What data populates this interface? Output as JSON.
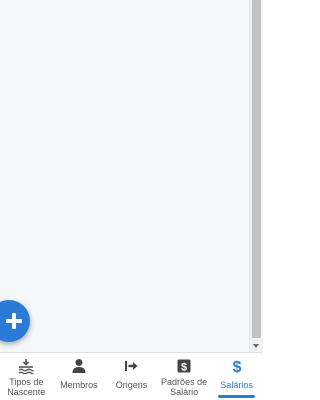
{
  "fab": {
    "icon": "plus-icon"
  },
  "bottom_nav": {
    "items": [
      {
        "label": "Tipos de\nNascente",
        "icon": "water-source-icon",
        "active": false
      },
      {
        "label": "Membros",
        "icon": "person-icon",
        "active": false
      },
      {
        "label": "Origens",
        "icon": "origin-arrow-icon",
        "active": false
      },
      {
        "label": "Padrões de\nSalário",
        "icon": "salary-pattern-icon",
        "active": false
      },
      {
        "label": "Salários",
        "icon": "dollar-icon",
        "active": true
      }
    ]
  },
  "colors": {
    "accent": "#2b7bd6",
    "icon_gray": "#555555",
    "background": "#f6f7f9"
  }
}
